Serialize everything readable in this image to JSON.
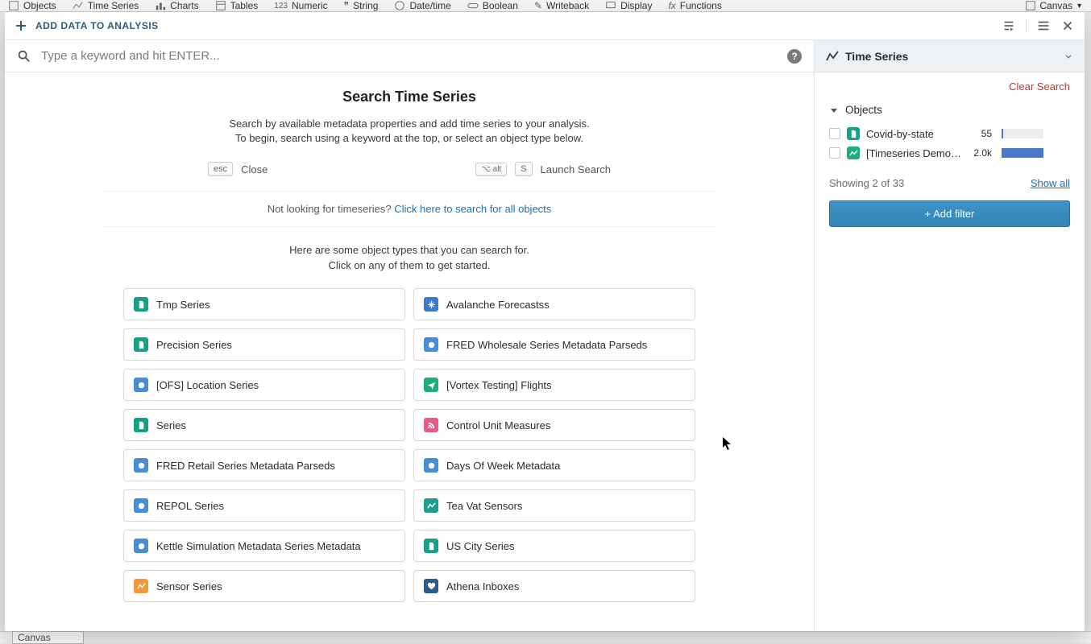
{
  "bg_tabs": {
    "objects": "Objects",
    "timeseries": "Time Series",
    "charts": "Charts",
    "tables": "Tables",
    "numeric": "Numeric",
    "string": "String",
    "datetime": "Date/time",
    "boolean": "Boolean",
    "writeback": "Writeback",
    "display": "Display",
    "functions": "Functions",
    "canvas": "Canvas"
  },
  "bg_bottom": {
    "canvas": "Canvas"
  },
  "header": {
    "add_data": "ADD DATA TO ANALYSIS"
  },
  "search": {
    "placeholder": "Type a keyword and hit ENTER..."
  },
  "content": {
    "title": "Search Time Series",
    "desc_l1": "Search by available metadata properties and add time series to your analysis.",
    "desc_l2": "To begin, search using a keyword at the top, or select an object type below.",
    "esc_key": "esc",
    "close": "Close",
    "alt_key": "alt",
    "s_key": "S",
    "launch": "Launch Search",
    "altlink_prefix": "Not looking for timeseries? ",
    "altlink": "Click here to search for all objects",
    "sub_l1": "Here are some object types that you can search for.",
    "sub_l2": "Click on any of them to get started.",
    "cards": [
      {
        "label": "Tmp Series",
        "color": "ic-teal",
        "glyph": "doc"
      },
      {
        "label": "Avalanche Forecastss",
        "color": "ic-blue",
        "glyph": "snow"
      },
      {
        "label": "Precision Series",
        "color": "ic-teal",
        "glyph": "doc"
      },
      {
        "label": "FRED Wholesale Series Metadata Parseds",
        "color": "ic-lblue",
        "glyph": "circle"
      },
      {
        "label": "[OFS] Location Series",
        "color": "ic-lblue",
        "glyph": "circle"
      },
      {
        "label": "[Vortex Testing] Flights",
        "color": "ic-green",
        "glyph": "plane"
      },
      {
        "label": "Series",
        "color": "ic-teal",
        "glyph": "doc"
      },
      {
        "label": "Control Unit Measures",
        "color": "ic-pink",
        "glyph": "rss"
      },
      {
        "label": "FRED Retail Series Metadata Parseds",
        "color": "ic-lblue",
        "glyph": "circle"
      },
      {
        "label": "Days Of Week Metadata",
        "color": "ic-lblue",
        "glyph": "circle"
      },
      {
        "label": "REPOL Series",
        "color": "ic-lblue",
        "glyph": "circle"
      },
      {
        "label": "Tea Vat Sensors",
        "color": "ic-tealstripe",
        "glyph": "chart"
      },
      {
        "label": "Kettle Simulation Metadata Series Metadata",
        "color": "ic-lblue",
        "glyph": "circle"
      },
      {
        "label": "US City Series",
        "color": "ic-teal",
        "glyph": "doc"
      },
      {
        "label": "Sensor Series",
        "color": "ic-orange",
        "glyph": "chart"
      },
      {
        "label": "Athena Inboxes",
        "color": "ic-dblue",
        "glyph": "heart"
      }
    ]
  },
  "sidebar": {
    "title": "Time Series",
    "clear": "Clear Search",
    "objects_label": "Objects",
    "rows": [
      {
        "name": "Covid-by-state",
        "count": "55",
        "pct": 3,
        "color": "ic-teal",
        "glyph": "doc"
      },
      {
        "name": "[Timeseries Demo] Stock S",
        "count": "2.0k",
        "pct": 100,
        "color": "ic-green",
        "glyph": "chart"
      }
    ],
    "showing": "Showing 2 of 33",
    "show_all": "Show all",
    "add_filter": "+ Add filter"
  }
}
